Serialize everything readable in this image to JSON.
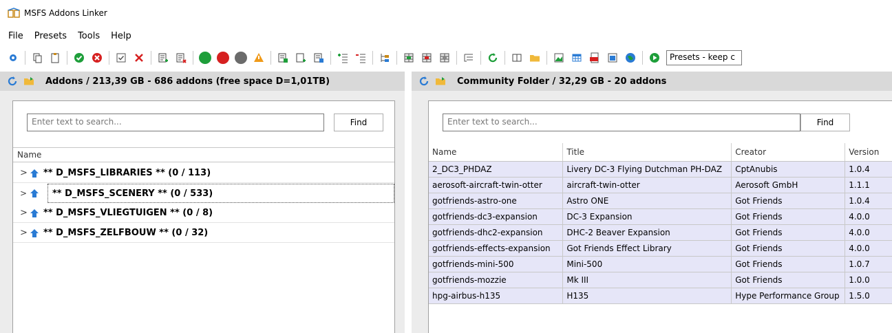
{
  "app": {
    "title": "MSFS Addons Linker"
  },
  "menu": [
    "File",
    "Presets",
    "Tools",
    "Help"
  ],
  "toolbar": {
    "presets_value": "Presets - keep c",
    "icons": [
      "settings-icon",
      "copy-icon",
      "paste-icon",
      "check-circle-icon",
      "cancel-circle-icon",
      "checkbox-icon",
      "close-x-icon",
      "list-add-icon",
      "list-remove-icon",
      "green-dot-icon",
      "red-dot-icon",
      "gray-dot-icon",
      "warning-icon",
      "export-icon",
      "new-doc-icon",
      "import-icon",
      "add-row-icon",
      "remove-row-icon",
      "tree-icon",
      "grid-a-icon",
      "grid-b-icon",
      "grid-c-icon",
      "outline-icon",
      "refresh-icon",
      "columns-icon",
      "folder-icon",
      "image-icon",
      "table-icon",
      "pdf-icon",
      "window-icon",
      "globe-icon",
      "play-icon"
    ]
  },
  "left_panel": {
    "header": "Addons / 213,39 GB - 686 addons (free space D=1,01TB)",
    "search_placeholder": "Enter text to search...",
    "find_label": "Find",
    "column_name": "Name",
    "items": [
      "** D_MSFS_LIBRARIES ** (0 / 113)",
      "** D_MSFS_SCENERY ** (0 / 533)",
      "** D_MSFS_VLIEGTUIGEN ** (0 / 8)",
      "** D_MSFS_ZELFBOUW ** (0 / 32)"
    ]
  },
  "right_panel": {
    "header": "Community Folder  / 32,29 GB - 20 addons",
    "search_placeholder": "Enter text to search...",
    "find_label": "Find",
    "columns": [
      "Name",
      "Title",
      "Creator",
      "Version"
    ],
    "rows": [
      [
        "2_DC3_PHDAZ",
        "Livery DC-3 Flying Dutchman PH-DAZ",
        "CptAnubis",
        "1.0.4"
      ],
      [
        "aerosoft-aircraft-twin-otter",
        "aircraft-twin-otter",
        "Aerosoft GmbH",
        "1.1.1"
      ],
      [
        "gotfriends-astro-one",
        "Astro ONE",
        "Got Friends",
        "1.0.4"
      ],
      [
        "gotfriends-dc3-expansion",
        "DC-3 Expansion",
        "Got Friends",
        "4.0.0"
      ],
      [
        "gotfriends-dhc2-expansion",
        "DHC-2 Beaver Expansion",
        "Got Friends",
        "4.0.0"
      ],
      [
        "gotfriends-effects-expansion",
        "Got Friends Effect Library",
        "Got Friends",
        "4.0.0"
      ],
      [
        "gotfriends-mini-500",
        "Mini-500",
        "Got Friends",
        "1.0.7"
      ],
      [
        "gotfriends-mozzie",
        "Mk III",
        "Got Friends",
        "1.0.0"
      ],
      [
        "hpg-airbus-h135",
        "H135",
        "Hype Performance Group",
        "1.5.0"
      ]
    ]
  },
  "colors": {
    "row_bg": "#e6e6f8",
    "header_bg": "#d9d9d9",
    "accent_blue": "#2a7bd4"
  }
}
